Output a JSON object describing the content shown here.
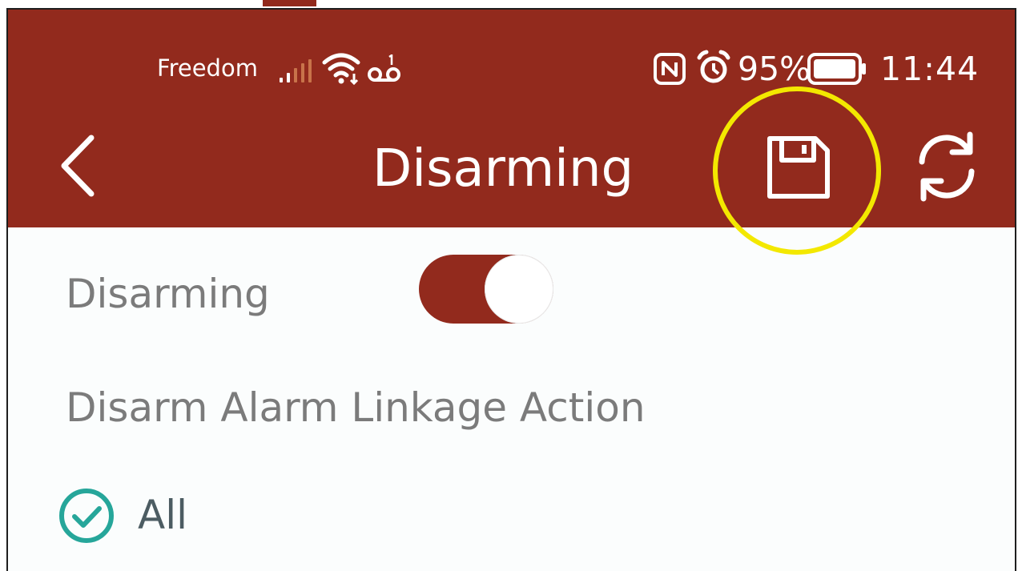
{
  "status_bar": {
    "carrier": "Freedom",
    "battery": "95%",
    "time": "11:44",
    "icons": [
      "signal-icon",
      "wifi-icon",
      "voicemail-icon",
      "nfc-icon",
      "alarm-icon",
      "battery-icon"
    ]
  },
  "app_bar": {
    "title": "Disarming",
    "back_icon": "chevron-left-icon",
    "save_icon": "floppy-disk-icon",
    "refresh_icon": "refresh-icon"
  },
  "settings": {
    "disarming_label": "Disarming",
    "disarming_enabled": true,
    "linkage_label": "Disarm Alarm Linkage Action",
    "all_label": "All",
    "all_checked": true
  },
  "colors": {
    "brand": "#922a1d",
    "highlight": "#f3e800",
    "check": "#26a69a",
    "label_gray": "#7b7b7b"
  }
}
